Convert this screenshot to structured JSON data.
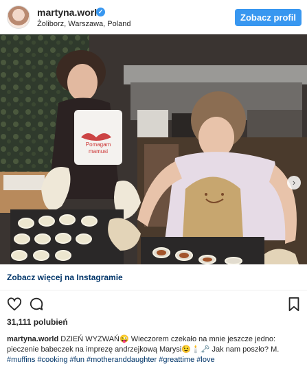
{
  "header": {
    "username": "martyna.world",
    "location": "Żoliborz, Warszawa, Poland",
    "profile_button": "Zobacz profil",
    "verified_glyph": "✓"
  },
  "photo": {
    "apron_text_line1": "Pomagam",
    "apron_text_line2": "mamusi",
    "next_arrow": "›"
  },
  "post": {
    "more_link": "Zobacz więcej na Instagramie",
    "likes": "31,111 polubień",
    "caption_user": "martyna.world",
    "caption_text": "DZIEŃ WYZWAŃ😜 Wieczorem czekało na mnie jeszcze jedno: pieczenie babeczek na imprezę andrzejkową Marysi😉🕯️🗝️ Jak nam poszło? M.",
    "hashtags": [
      "#muffins",
      "#cooking",
      "#fun",
      "#motheranddaughter",
      "#greattime",
      "#love"
    ]
  },
  "icons": {
    "like": "heart-icon",
    "comment": "comment-icon",
    "save": "bookmark-icon"
  },
  "colors": {
    "accent": "#3897f0",
    "link": "#003569",
    "text": "#262626"
  }
}
